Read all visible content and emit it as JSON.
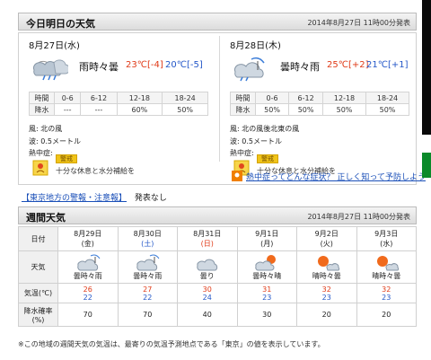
{
  "today": {
    "header": {
      "title": "今日明日の天気",
      "announce": "2014年8月27日 11時00分発表"
    },
    "days": [
      {
        "date": "8月27日(水)",
        "weather": "雨時々曇",
        "weather_icon": "rain-cloud-icon",
        "high": "23℃",
        "high_diff": "[-4]",
        "low": "20℃",
        "low_diff": "[-5]",
        "rain": {
          "label_time": "時間",
          "label_rain": "降水",
          "periods": [
            "0-6",
            "6-12",
            "12-18",
            "18-24"
          ],
          "values": [
            "---",
            "---",
            "60%",
            "50%"
          ]
        },
        "wind": "風: 北の風",
        "wave": "波: 0.5メートル",
        "heat_label": "熱中症:",
        "heat_badge": "警戒",
        "heat_text": "十分な休息と水分補給を"
      },
      {
        "date": "8月28日(木)",
        "weather": "曇時々雨",
        "weather_icon": "cloud-rain-icon",
        "high": "25℃",
        "high_diff": "[+2]",
        "low": "21℃",
        "low_diff": "[+1]",
        "rain": {
          "label_time": "時間",
          "label_rain": "降水",
          "periods": [
            "0-6",
            "6-12",
            "12-18",
            "18-24"
          ],
          "values": [
            "50%",
            "50%",
            "50%",
            "50%"
          ]
        },
        "wind": "風: 北の風後北東の風",
        "wave": "波: 0.5メートル",
        "heat_label": "熱中症:",
        "heat_badge": "警戒",
        "heat_text": "十分な休息と水分補給を"
      }
    ],
    "heat_link": "熱中症ってどんな症状？ 正しく知って予防しよう",
    "warning_link": "【東京地方の警報・注意報】",
    "warning_text": "発表なし"
  },
  "weekly": {
    "header": {
      "title": "週間天気",
      "announce": "2014年8月27日 11時00分発表"
    },
    "labels": {
      "date": "日付",
      "weather": "天気",
      "temp": "気温(℃)",
      "rain": "降水確率(%)"
    },
    "days": [
      {
        "md": "8月29日",
        "dow": "(金)",
        "dow_type": "weekday",
        "weather": "曇時々雨",
        "icon": "cloud-rain-icon",
        "high": "26",
        "low": "22",
        "rain": "70"
      },
      {
        "md": "8月30日",
        "dow": "(土)",
        "dow_type": "sat",
        "weather": "曇時々雨",
        "icon": "cloud-rain-icon",
        "high": "27",
        "low": "22",
        "rain": "70"
      },
      {
        "md": "8月31日",
        "dow": "(日)",
        "dow_type": "sun",
        "weather": "曇り",
        "icon": "cloud-icon",
        "high": "30",
        "low": "24",
        "rain": "40"
      },
      {
        "md": "9月1日",
        "dow": "(月)",
        "dow_type": "weekday",
        "weather": "曇時々晴",
        "icon": "cloud-sun-icon",
        "high": "31",
        "low": "23",
        "rain": "30"
      },
      {
        "md": "9月2日",
        "dow": "(火)",
        "dow_type": "weekday",
        "weather": "晴時々曇",
        "icon": "sun-cloud-icon",
        "high": "32",
        "low": "23",
        "rain": "20"
      },
      {
        "md": "9月3日",
        "dow": "(水)",
        "dow_type": "weekday",
        "weather": "晴時々曇",
        "icon": "sun-cloud-icon",
        "high": "32",
        "low": "23",
        "rain": "20"
      }
    ],
    "footnote": "※この地域の週間天気の気温は、最寄りの気温予測地点である「東京」の値を表示しています。"
  }
}
